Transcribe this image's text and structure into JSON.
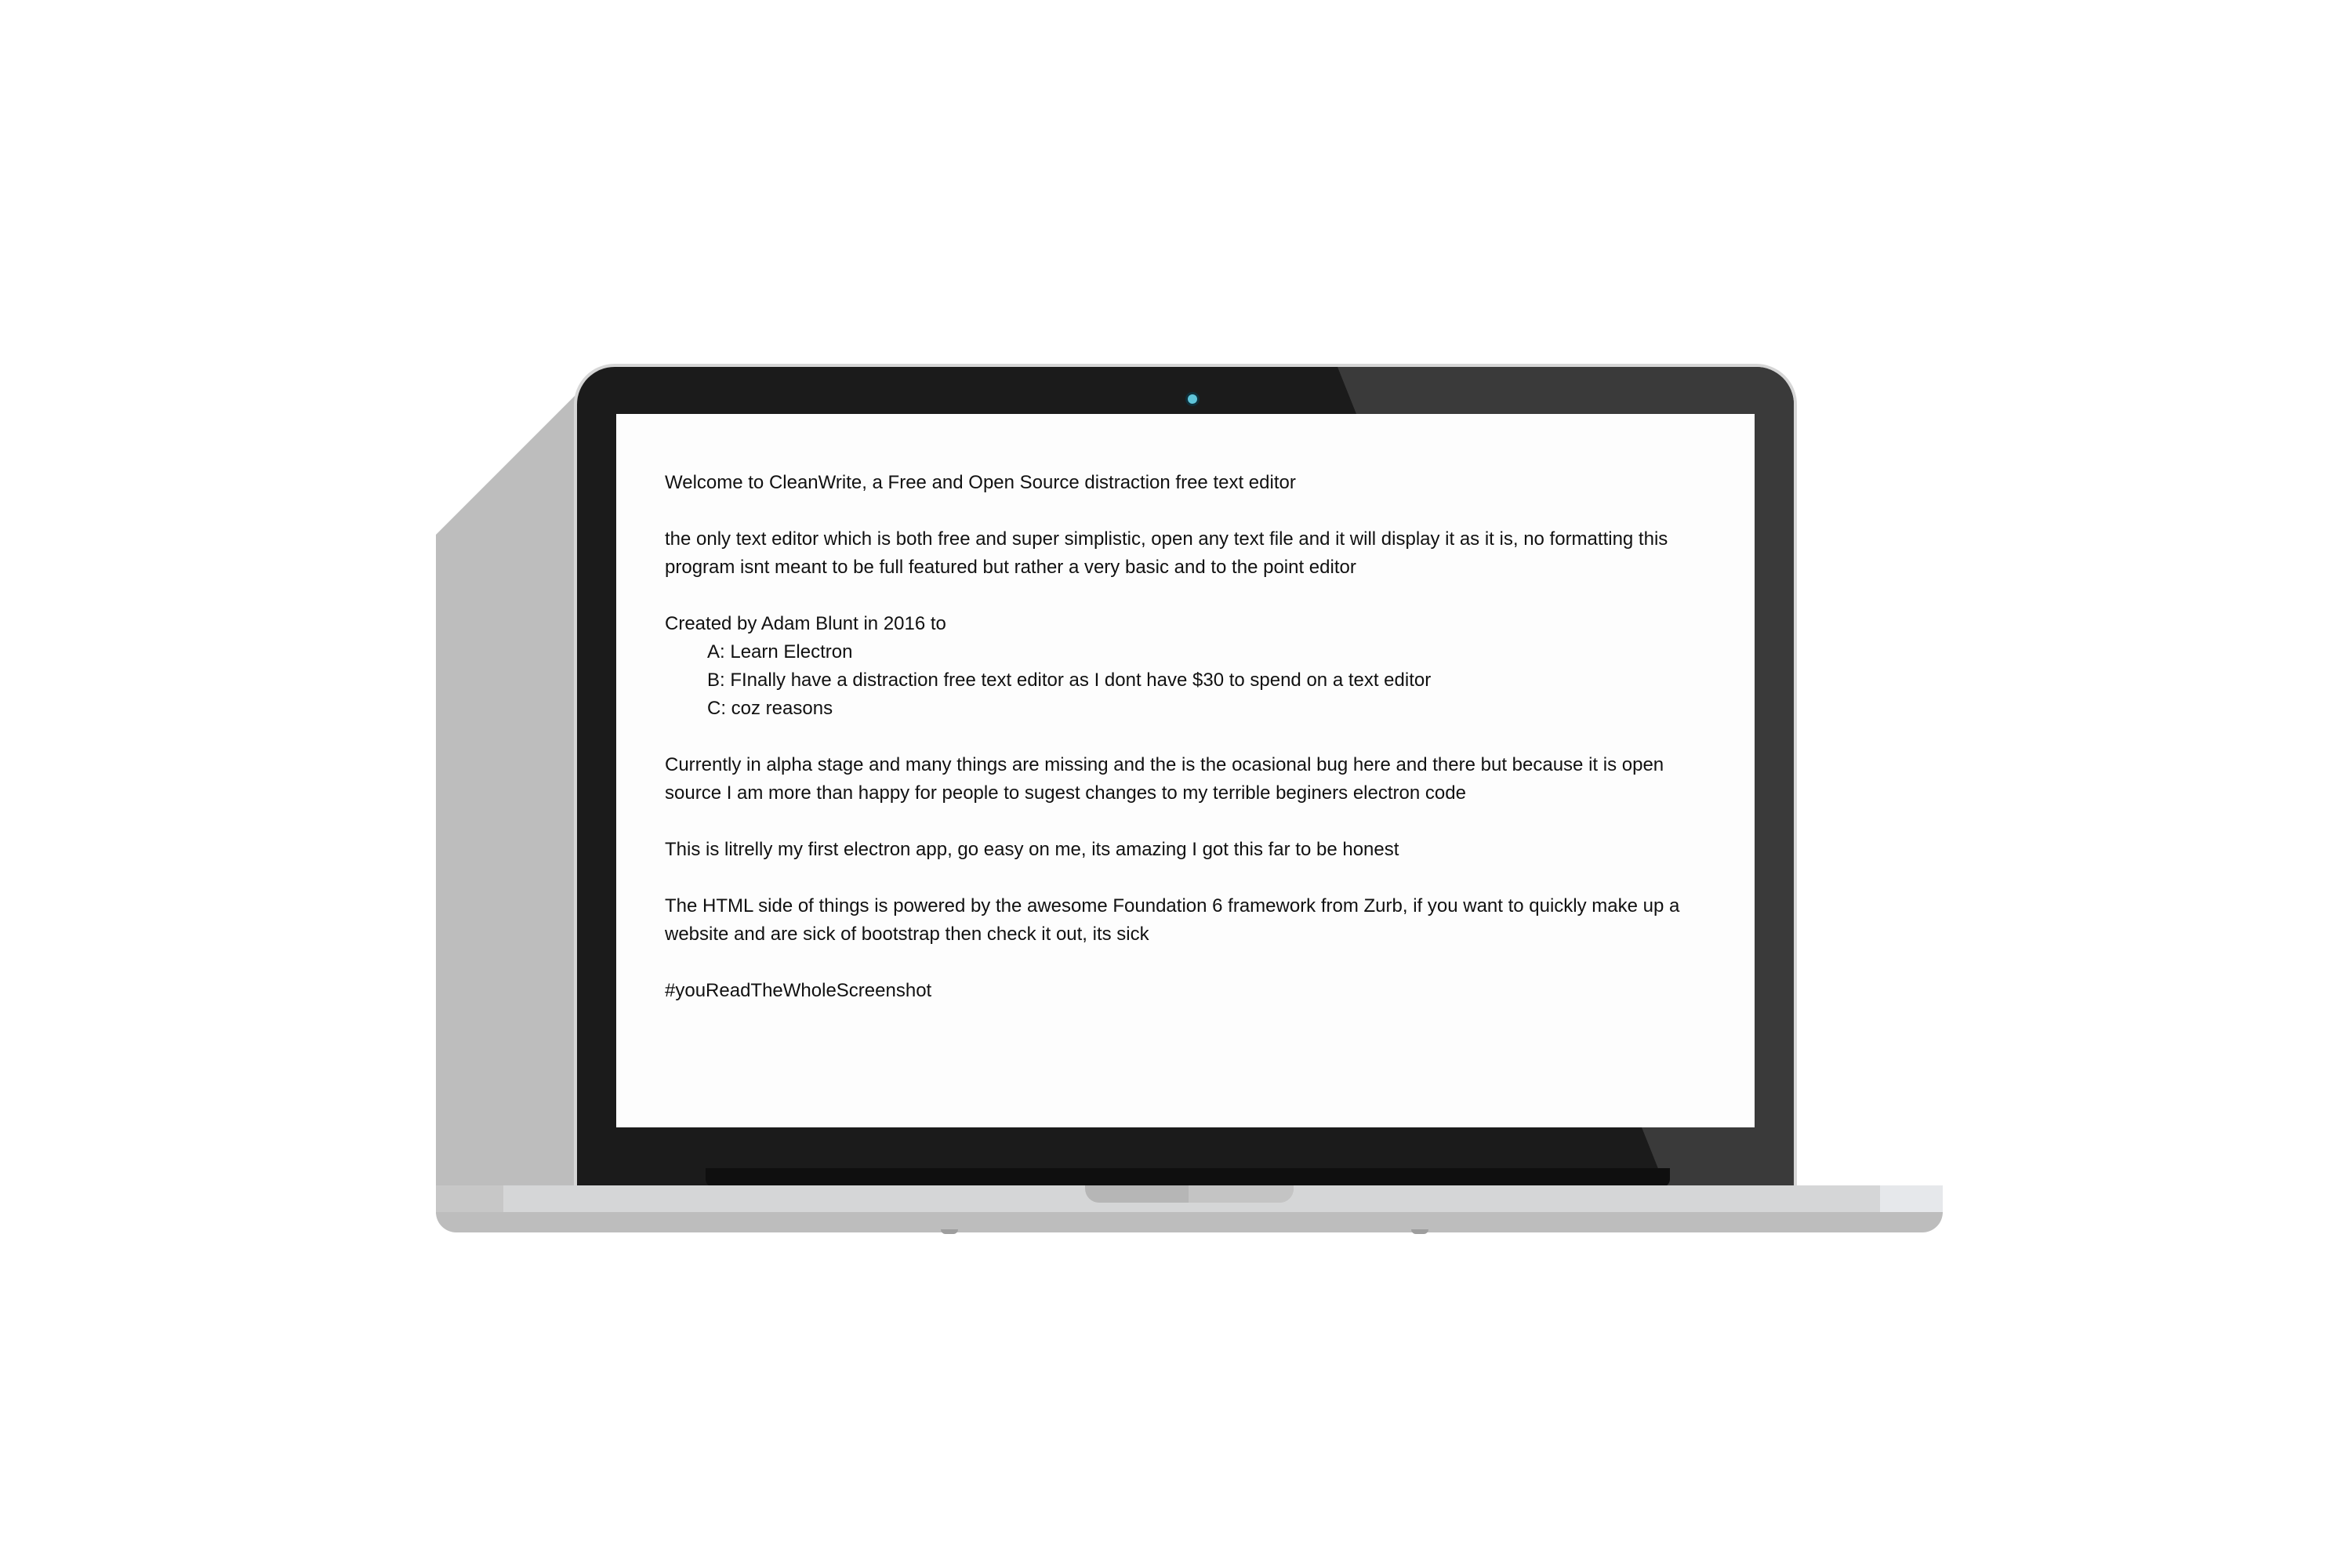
{
  "app": {
    "name": "CleanWrite"
  },
  "editor": {
    "line1": "Welcome to CleanWrite, a Free and Open Source distraction free text editor",
    "para2": "the only text editor which is both free and super simplistic, open any text file and it will display it as it is, no formatting this program isnt meant to be full featured but rather a very basic and to the point editor",
    "created": "Created by Adam Blunt in 2016 to",
    "reasons": [
      "A: Learn Electron",
      "B: FInally have a distraction free text editor as I dont have $30 to spend on a text editor",
      "C: coz reasons"
    ],
    "para4": "Currently in alpha stage and many things are missing and the is the ocasional bug here and there but because it is open source I am more than happy for people to sugest changes to my terrible beginers electron code",
    "para5": "This is litrelly my first electron app, go easy on me, its amazing I got this far to be honest",
    "para6": "The HTML side of things is powered by the awesome Foundation 6 framework from Zurb, if you want to quickly make up a website and are sick of bootstrap then check it out, its sick",
    "hashtag": "#youReadTheWholeScreenshot"
  },
  "colors": {
    "background": "#ffffff",
    "bezel": "#1b1b1b",
    "screen": "#fdfdfd",
    "text": "#111111",
    "shadow": "#bdbdbd",
    "camera": "#5fc4d9"
  }
}
